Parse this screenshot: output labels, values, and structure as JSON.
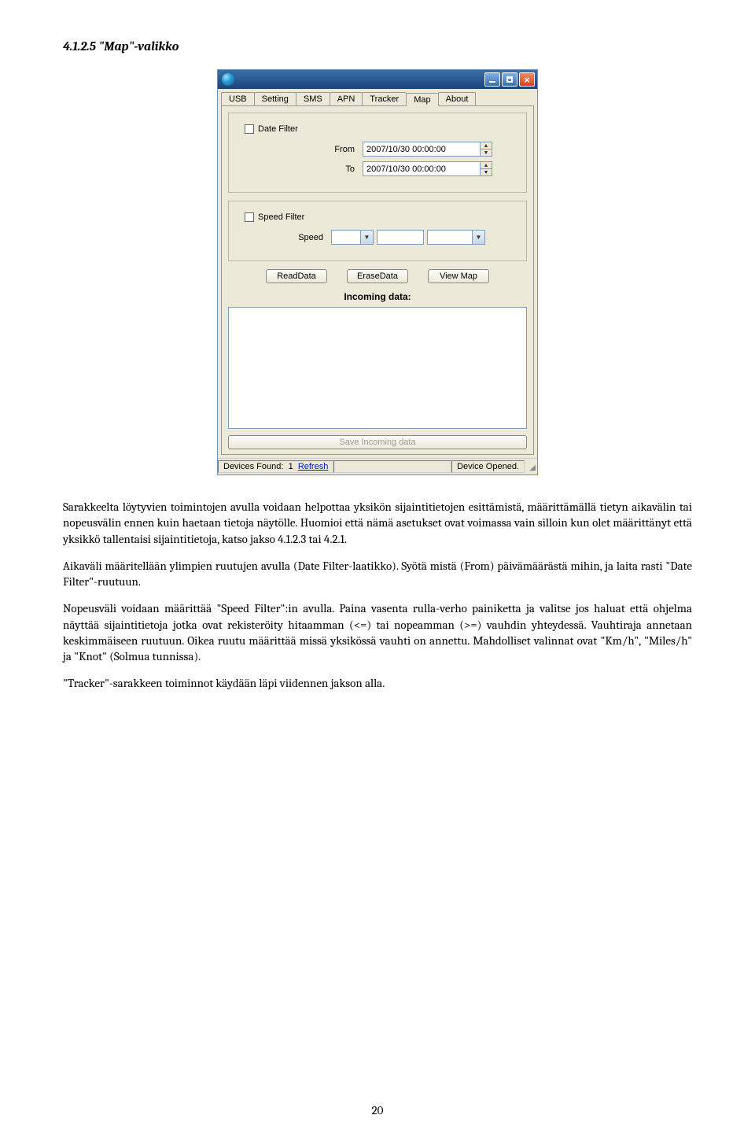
{
  "heading": "4.1.2.5 \"Map\"-valikko",
  "window": {
    "tabs": {
      "t0": "USB",
      "t1": "Setting",
      "t2": "SMS",
      "t3": "APN",
      "t4": "Tracker",
      "t5": "Map",
      "t6": "About"
    },
    "date_filter": {
      "checkbox_label": "Date Filter",
      "from_label": "From",
      "from_value": "2007/10/30 00:00:00",
      "to_label": "To",
      "to_value": "2007/10/30 00:00:00"
    },
    "speed_filter": {
      "checkbox_label": "Speed Filter",
      "speed_label": "Speed"
    },
    "buttons": {
      "read": "ReadData",
      "erase": "EraseData",
      "viewmap": "View Map",
      "save": "Save Incoming data"
    },
    "incoming_label": "Incoming data:",
    "status": {
      "devices_found_label": "Devices Found:",
      "devices_found_value": "1",
      "refresh": "Refresh",
      "device_opened": "Device Opened."
    }
  },
  "paragraphs": {
    "p1": "Sarakkeelta löytyvien toimintojen avulla voidaan helpottaa yksikön sijaintitietojen esittämistä, määrittämällä tietyn aikavälin tai nopeusvälin ennen kuin haetaan tietoja näytölle. Huomioi että nämä asetukset ovat voimassa vain silloin kun olet määrittänyt että yksikkö tallentaisi sijaintitietoja, katso jakso 4.1.2.3 tai 4.2.1.",
    "p2": "Aikaväli määritellään ylimpien ruutujen avulla (Date Filter-laatikko). Syötä mistä (From) päivämäärästä mihin, ja laita rasti \"Date Filter\"-ruutuun.",
    "p3": "Nopeusväli voidaan määrittää \"Speed Filter\":in avulla. Paina vasenta rulla-verho painiketta ja valitse jos haluat että ohjelma näyttää sijaintitietoja jotka ovat rekisteröity hitaamman (<=) tai nopeamman (>=) vauhdin yhteydessä.  Vauhtiraja annetaan keskimmäiseen ruutuun. Oikea ruutu määrittää missä yksikössä vauhti on annettu. Mahdolliset valinnat ovat \"Km/h\", \"Miles/h\" ja \"Knot\" (Solmua tunnissa).",
    "p4": "\"Tracker\"-sarakkeen toiminnot käydään läpi viidennen jakson alla."
  },
  "page_number": "20"
}
